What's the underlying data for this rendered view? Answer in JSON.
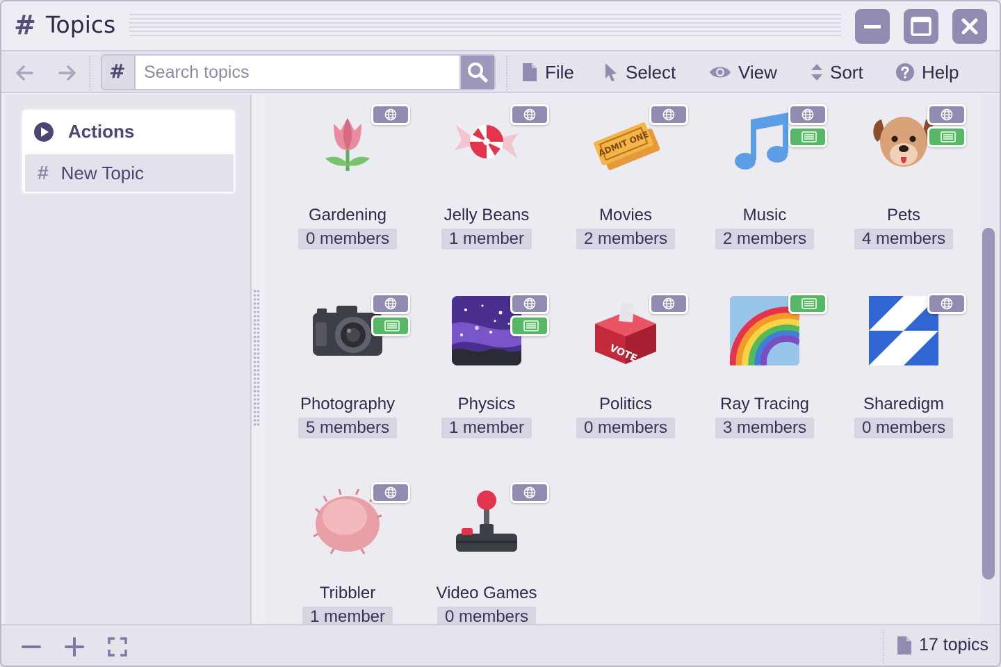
{
  "window": {
    "title_hash": "#",
    "title": "Topics"
  },
  "toolbar": {
    "search_hash": "#",
    "search_placeholder": "Search topics",
    "menu": [
      {
        "label": "File",
        "icon": "file-icon"
      },
      {
        "label": "Select",
        "icon": "cursor-icon"
      },
      {
        "label": "View",
        "icon": "eye-icon"
      },
      {
        "label": "Sort",
        "icon": "sort-icon"
      },
      {
        "label": "Help",
        "icon": "help-icon"
      }
    ]
  },
  "sidebar": {
    "actions_title": "Actions",
    "new_topic_hash": "#",
    "new_topic_label": "New Topic"
  },
  "topics": [
    {
      "name": "Gardening",
      "count": "0 members",
      "icon": "tulip-icon",
      "badges": [
        "globe"
      ]
    },
    {
      "name": "Jelly Beans",
      "count": "1 member",
      "icon": "candy-icon",
      "badges": [
        "globe"
      ]
    },
    {
      "name": "Movies",
      "count": "2 members",
      "icon": "ticket-icon",
      "badges": [
        "globe"
      ],
      "ticket_text": "ADMIT ONE"
    },
    {
      "name": "Music",
      "count": "2 members",
      "icon": "music-note-icon",
      "badges": [
        "globe",
        "doc"
      ]
    },
    {
      "name": "Pets",
      "count": "4 members",
      "icon": "dog-icon",
      "badges": [
        "globe",
        "doc"
      ]
    },
    {
      "name": "Photography",
      "count": "5 members",
      "icon": "camera-icon",
      "badges": [
        "globe",
        "doc"
      ]
    },
    {
      "name": "Physics",
      "count": "1 member",
      "icon": "galaxy-icon",
      "badges": [
        "globe",
        "doc"
      ]
    },
    {
      "name": "Politics",
      "count": "0 members",
      "icon": "ballot-box-icon",
      "badges": [
        "globe"
      ],
      "ballot_text": "VOTE"
    },
    {
      "name": "Ray Tracing",
      "count": "3 members",
      "icon": "rainbow-icon",
      "badges": [
        "doc"
      ]
    },
    {
      "name": "Sharedigm",
      "count": "0 members",
      "icon": "sharedigm-logo-icon",
      "badges": [
        "globe"
      ]
    },
    {
      "name": "Tribbler",
      "count": "1 member",
      "icon": "tribble-icon",
      "badges": [
        "globe"
      ]
    },
    {
      "name": "Video Games",
      "count": "0 members",
      "icon": "joystick-icon",
      "badges": [
        "globe"
      ]
    }
  ],
  "status": {
    "count_label": "17 topics"
  },
  "colors": {
    "accent": "#8f8bb1",
    "text": "#2f2a4a",
    "doc_badge": "#54b864"
  }
}
